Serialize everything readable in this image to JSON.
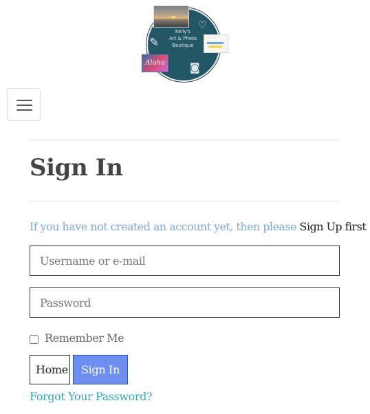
{
  "logo": {
    "text_line_1": "Kelly's",
    "text_line_2": "Art & Photo",
    "text_line_3": "Boutique",
    "ticket_text": "Aloha",
    "icon_names": [
      "heart-icon",
      "camera-icon",
      "photo-camera-icon"
    ]
  },
  "navigation": {
    "menu_icon": "hamburger-menu-icon"
  },
  "page": {
    "title": "Sign In",
    "signup_prompt": "If you have not created an account yet, then please",
    "signup_link": "Sign Up first"
  },
  "form": {
    "username_placeholder": "Username or e-mail",
    "username_value": "",
    "password_placeholder": "Password",
    "password_value": "",
    "remember_label": "Remember Me",
    "remember_checked": false,
    "home_button": "Home",
    "signin_button": "Sign In",
    "forgot_link": "Forgot Your Password?"
  },
  "colors": {
    "logo_background": "#245766",
    "prompt_text": "#7ea9d7",
    "forgot_link": "#36a7bd",
    "signin_button": "#6f8ff0",
    "border": "#333333"
  }
}
